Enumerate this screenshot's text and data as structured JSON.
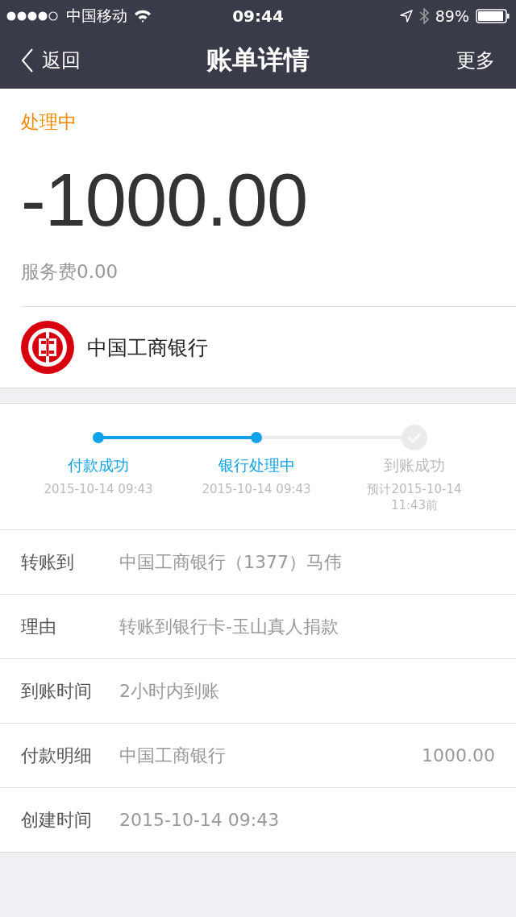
{
  "status_bar": {
    "carrier": "中国移动",
    "time": "09:44",
    "battery": "89%"
  },
  "nav": {
    "back": "返回",
    "title": "账单详情",
    "more": "更多"
  },
  "summary": {
    "status": "处理中",
    "amount": "-1000.00",
    "fee": "服务费0.00",
    "bank": "中国工商银行"
  },
  "steps": [
    {
      "label": "付款成功",
      "time": "2015-10-14 09:43",
      "done": true
    },
    {
      "label": "银行处理中",
      "time": "2015-10-14 09:43",
      "done": true
    },
    {
      "label": "到账成功",
      "time": "预计2015-10-14 11:43前",
      "done": false
    }
  ],
  "details": [
    {
      "label": "转账到",
      "value": "中国工商银行（1377）马伟"
    },
    {
      "label": "理由",
      "value": "转账到银行卡-玉山真人捐款"
    },
    {
      "label": "到账时间",
      "value": "2小时内到账"
    },
    {
      "label": "付款明细",
      "value": "中国工商银行",
      "amount": "1000.00"
    },
    {
      "label": "创建时间",
      "value": "2015-10-14 09:43"
    }
  ]
}
